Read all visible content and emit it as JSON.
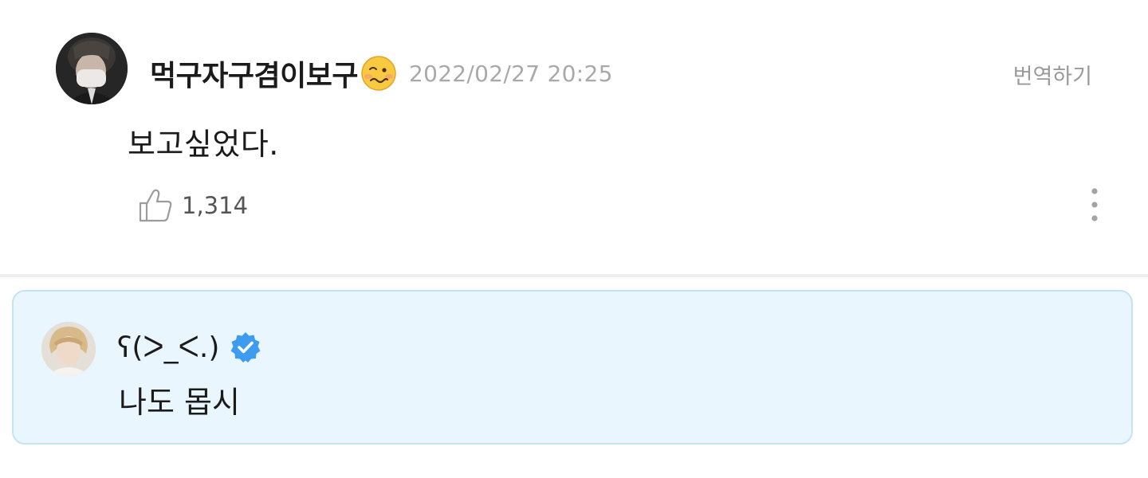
{
  "comment": {
    "author": "먹구자구겸이보구",
    "author_emoji_icon": "woozy-face-emoji",
    "timestamp": "2022/02/27 20:25",
    "translate_label": "번역하기",
    "text": "보고싶었다.",
    "likes": "1,314",
    "like_icon": "thumbs-up-icon",
    "more_icon": "more-vertical-icon"
  },
  "reply": {
    "author": "ʕ(ᐳ_ᐸ.)",
    "verified_icon": "verified-badge-icon",
    "text": "나도 몹시"
  },
  "colors": {
    "reply_background": "#e9f6fd",
    "reply_border": "#c5e3f0",
    "verified_blue": "#3d9bf0",
    "timestamp_gray": "#a9a9a9"
  }
}
